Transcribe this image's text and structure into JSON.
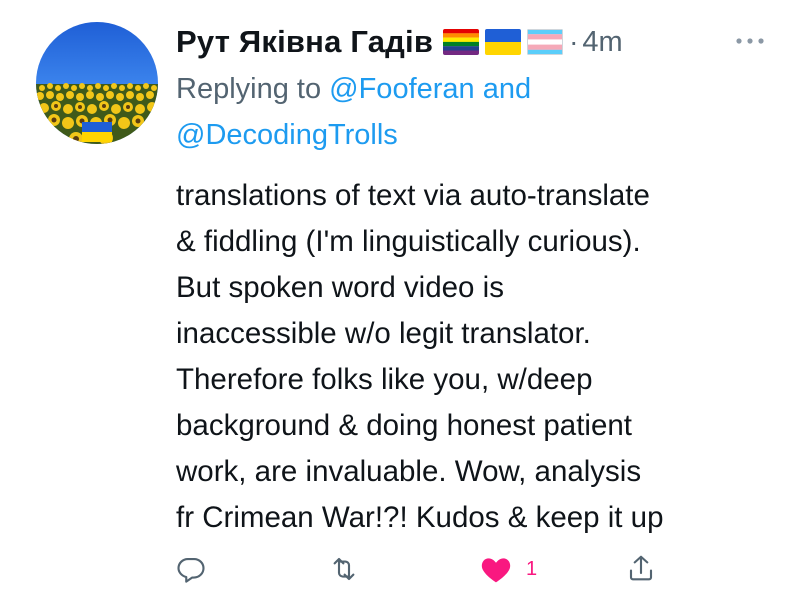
{
  "tweet": {
    "author": {
      "display_name": "Рут Яківна Гадів",
      "avatar_icon": "sunflower-field-avatar",
      "flags": [
        "rainbow-flag-icon",
        "ukraine-flag-icon",
        "transgender-flag-icon"
      ]
    },
    "time_separator": "·",
    "timestamp": "4m",
    "more_icon": "more-dots-icon",
    "reply": {
      "prefix": "Replying to ",
      "mention_1": "@Fooferan",
      "joiner": " and",
      "mention_2": "@DecodingTrolls"
    },
    "text_lines": [
      "translations of text via auto-translate",
      "& fiddling (I'm linguistically curious).",
      "But spoken word video is",
      "inaccessible w/o legit translator.",
      "Therefore folks like you, w/deep",
      "background & doing honest patient",
      "work, are invaluable. Wow, analysis",
      "fr Crimean War!?! Kudos & keep it up"
    ],
    "actions": {
      "reply_icon": "reply-icon",
      "retweet_icon": "retweet-icon",
      "like_icon": "heart-filled-icon",
      "like_count": "1",
      "share_icon": "share-icon"
    }
  },
  "colors": {
    "text": "#0f1419",
    "secondary": "#536471",
    "link": "#1d9bf0",
    "like": "#f91880"
  }
}
